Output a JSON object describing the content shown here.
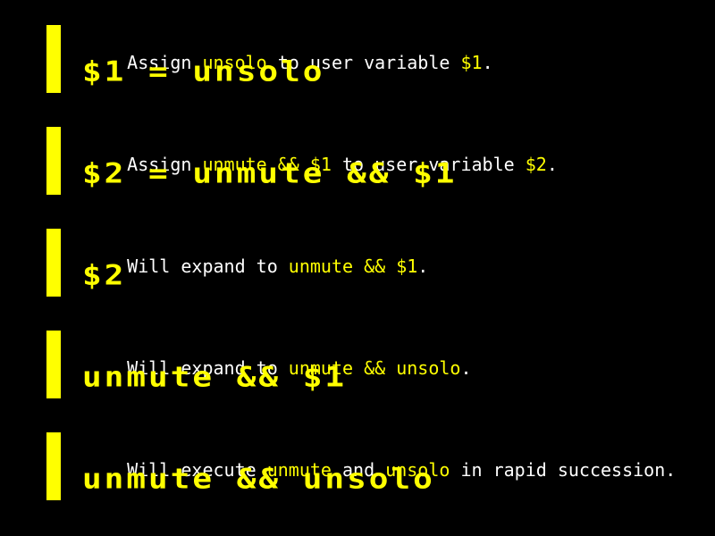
{
  "colors": {
    "background": "#000000",
    "text": "#ffffff",
    "highlight": "#ffff00",
    "bar": "#ffff00"
  },
  "steps": [
    {
      "desc": [
        {
          "text": "Assign ",
          "hl": false
        },
        {
          "text": "unsolo",
          "hl": true
        },
        {
          "text": " to user variable ",
          "hl": false
        },
        {
          "text": "$1",
          "hl": true
        },
        {
          "text": ".",
          "hl": false
        }
      ],
      "command": "$1 = unsolo"
    },
    {
      "desc": [
        {
          "text": "Assign ",
          "hl": false
        },
        {
          "text": "unmute && $1",
          "hl": true
        },
        {
          "text": " to user variable ",
          "hl": false
        },
        {
          "text": "$2",
          "hl": true
        },
        {
          "text": ".",
          "hl": false
        }
      ],
      "command": "$2 = unmute && $1"
    },
    {
      "desc": [
        {
          "text": "Will expand to ",
          "hl": false
        },
        {
          "text": "unmute && $1",
          "hl": true
        },
        {
          "text": ".",
          "hl": false
        }
      ],
      "command": "$2"
    },
    {
      "desc": [
        {
          "text": "Will expand to ",
          "hl": false
        },
        {
          "text": "unmute && unsolo",
          "hl": true
        },
        {
          "text": ".",
          "hl": false
        }
      ],
      "command": "unmute && $1"
    },
    {
      "desc": [
        {
          "text": "Will execute ",
          "hl": false
        },
        {
          "text": "unmute",
          "hl": true
        },
        {
          "text": " and ",
          "hl": false
        },
        {
          "text": "unsolo",
          "hl": true
        },
        {
          "text": " in rapid succession.",
          "hl": false
        }
      ],
      "command": "unmute && unsolo"
    }
  ]
}
